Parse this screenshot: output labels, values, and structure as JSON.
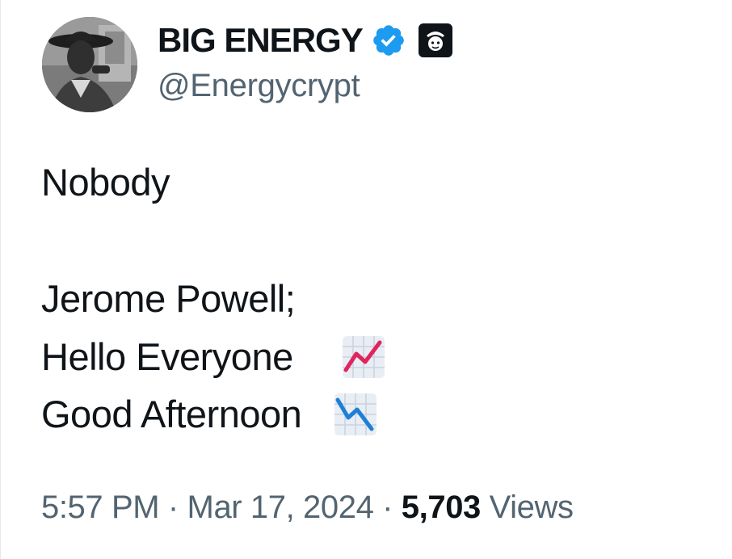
{
  "author": {
    "display_name": "BIG ENERGY",
    "handle": "@Energycrypt",
    "verified_icon": "verified-badge-icon",
    "affiliate_icon": "affiliate-badge-icon",
    "avatar_icon": "profile-avatar"
  },
  "tweet": {
    "lines": [
      "Nobody",
      "Jerome Powell;",
      "Hello Everyone",
      "Good Afternoon"
    ],
    "emojis": {
      "line3": "chart-increasing-icon",
      "line4": "chart-decreasing-icon"
    }
  },
  "meta": {
    "time": "5:57 PM",
    "separator": "·",
    "date": "Mar 17, 2024",
    "views_count": "5,703",
    "views_label": "Views"
  },
  "colors": {
    "text_primary": "#0f1419",
    "text_secondary": "#536471",
    "verified_blue": "#1d9bf0",
    "chart_up_red": "#e0245e",
    "chart_down_blue": "#1d7fd6"
  }
}
